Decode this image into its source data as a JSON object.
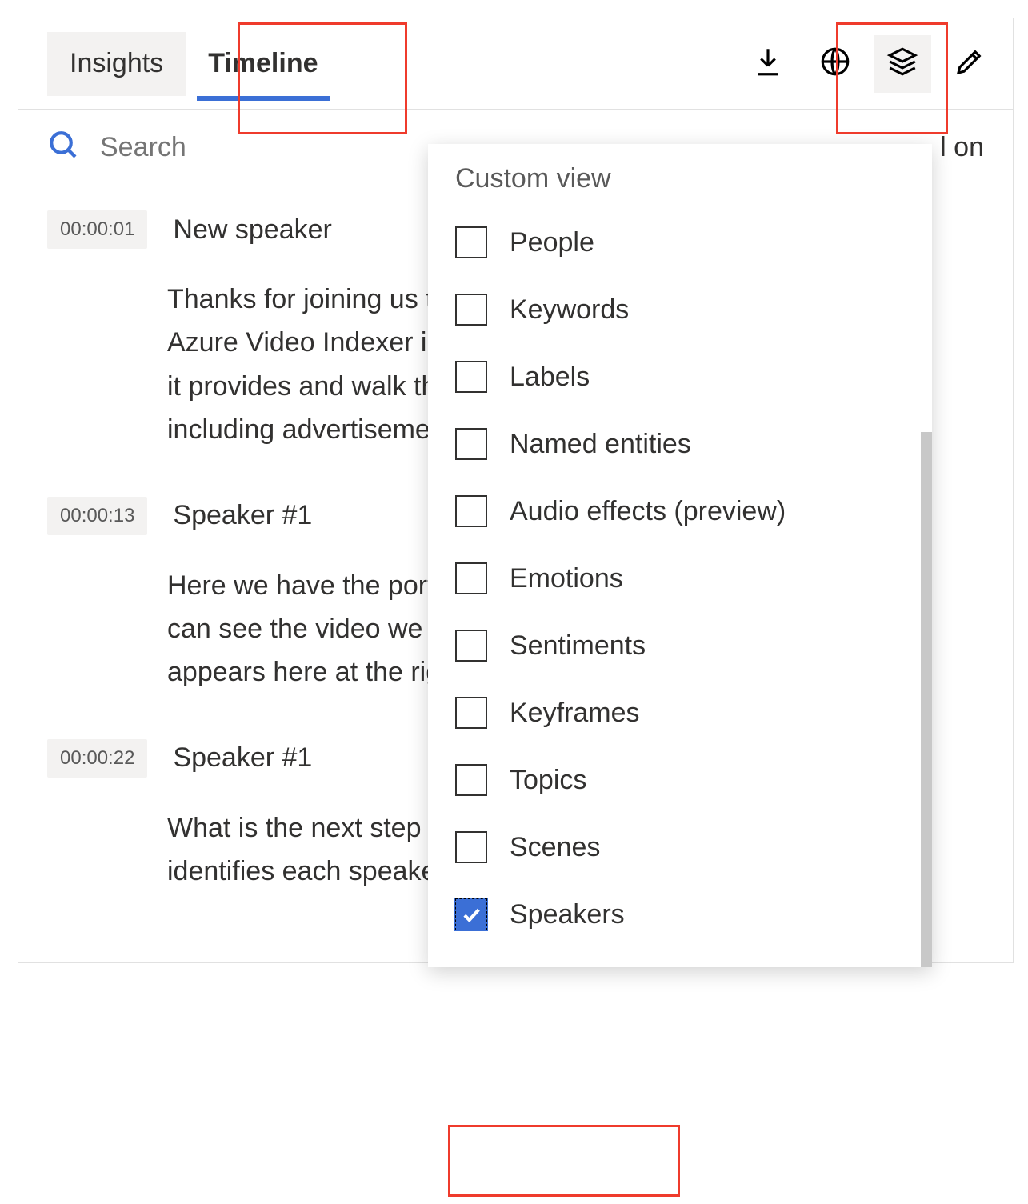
{
  "tabs": {
    "insights": "Insights",
    "timeline": "Timeline"
  },
  "search": {
    "placeholder": "Search"
  },
  "autoscroll_text": "l on",
  "entries": [
    {
      "time": "00:00:01",
      "speaker": "New speaker",
      "text": "Thanks for joining us today. Welcome to this session on Azure Video Indexer insight. We'll look closely at the value it provides and walk through a few common scenarios, including advertisement."
    },
    {
      "time": "00:00:13",
      "speaker": "Speaker #1",
      "text": "Here we have the portal open, and on the left side you can see the video we uploaded earlier. The insights panel appears here at the right."
    },
    {
      "time": "00:00:22",
      "speaker": "Speaker #1",
      "text": "What is the next step we want to explore? This insight identifies each speaker segment."
    }
  ],
  "dropdown": {
    "title": "Custom view",
    "items": [
      {
        "label": "People",
        "checked": false
      },
      {
        "label": "Keywords",
        "checked": false
      },
      {
        "label": "Labels",
        "checked": false
      },
      {
        "label": "Named entities",
        "checked": false
      },
      {
        "label": "Audio effects (preview)",
        "checked": false
      },
      {
        "label": "Emotions",
        "checked": false
      },
      {
        "label": "Sentiments",
        "checked": false
      },
      {
        "label": "Keyframes",
        "checked": false
      },
      {
        "label": "Topics",
        "checked": false
      },
      {
        "label": "Scenes",
        "checked": false
      },
      {
        "label": "Speakers",
        "checked": true
      }
    ]
  }
}
